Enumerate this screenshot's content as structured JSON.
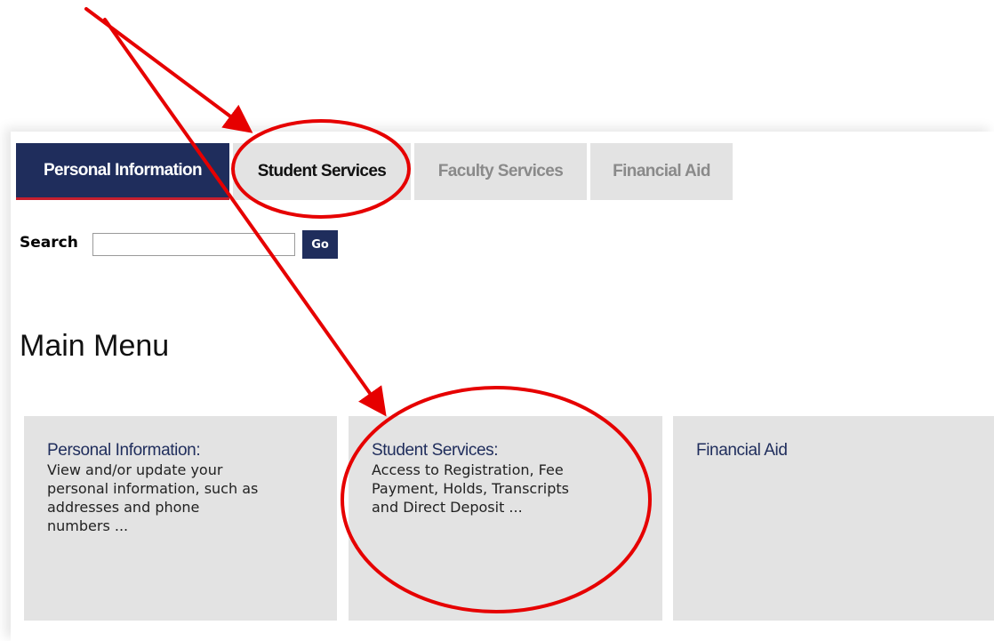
{
  "nav": {
    "tabs": [
      {
        "label": "Personal Information",
        "state": "active"
      },
      {
        "label": "Student Services",
        "state": "normal"
      },
      {
        "label": "Faculty Services",
        "state": "muted"
      },
      {
        "label": "Financial Aid",
        "state": "muted"
      }
    ]
  },
  "search": {
    "label": "Search",
    "value": "",
    "go_label": "Go"
  },
  "main": {
    "title": "Main Menu",
    "cards": [
      {
        "title": "Personal Information:",
        "desc_lines": [
          "View and/or update your",
          "personal information, such as",
          "addresses and phone",
          "numbers ..."
        ]
      },
      {
        "title": "Student Services:",
        "desc_lines": [
          "Access to Registration, Fee",
          "Payment, Holds, Transcripts",
          "and Direct Deposit ..."
        ]
      },
      {
        "title": "Financial Aid",
        "desc_lines": []
      }
    ]
  },
  "colors": {
    "brand_navy": "#1f2d5c",
    "accent_red": "#c51f2e",
    "tab_gray": "#e3e3e3",
    "annotation_red": "#e60000"
  }
}
